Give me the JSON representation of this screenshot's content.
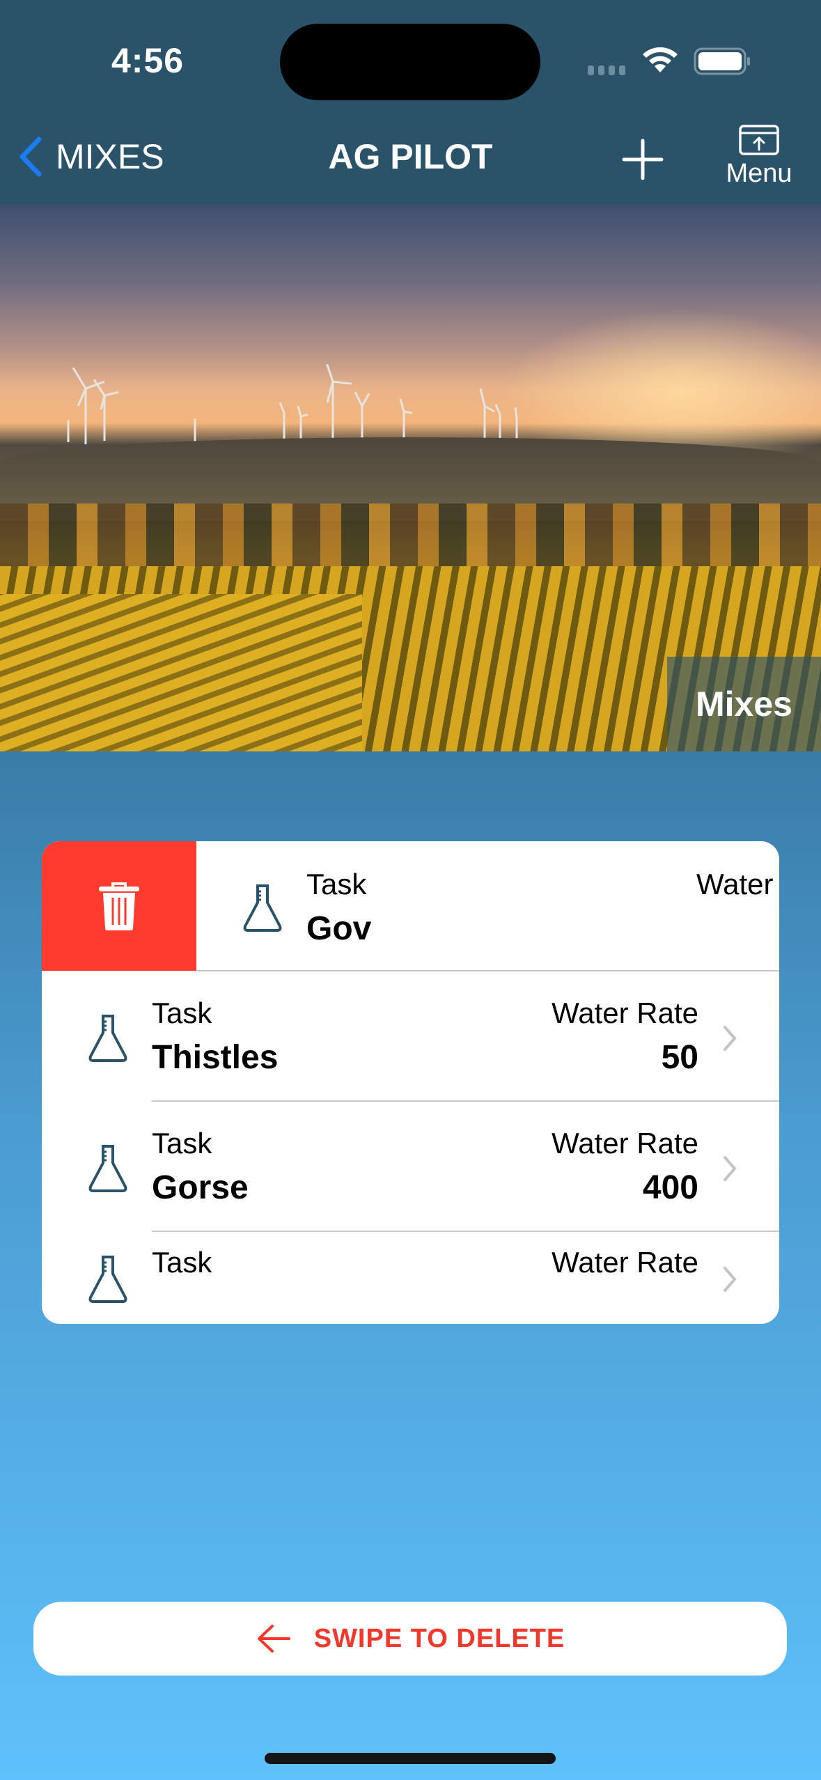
{
  "status_bar": {
    "time": "4:56",
    "icons": [
      "cellular-signal-icon",
      "wifi-icon",
      "battery-icon"
    ]
  },
  "nav": {
    "back_label": "MIXES",
    "title": "AG PILOT",
    "add_icon": "plus-icon",
    "menu_label": "Menu",
    "menu_icon": "share-upload-icon"
  },
  "hero": {
    "badge_label": "Mixes",
    "image_description": "sunset over vineyard with wind turbines"
  },
  "list": {
    "swipe_action": {
      "icon": "trash-icon",
      "color": "#ff3b30"
    },
    "rows": [
      {
        "task_label": "Task",
        "task_name": "Gov",
        "rate_label": "Water",
        "rate_value": ""
      },
      {
        "task_label": "Task",
        "task_name": "Thistles",
        "rate_label": "Water Rate",
        "rate_value": "50"
      },
      {
        "task_label": "Task",
        "task_name": "Gorse",
        "rate_label": "Water Rate",
        "rate_value": "400"
      },
      {
        "task_label": "Task",
        "task_name": "",
        "rate_label": "Water Rate",
        "rate_value": ""
      }
    ]
  },
  "footer": {
    "swipe_hint_label": "SWIPE TO DELETE",
    "swipe_hint_icon": "arrow-left-icon",
    "accent_color": "#f0392c"
  },
  "colors": {
    "nav_bar": "#2a5369",
    "icon_tint": "#2a5369",
    "back_chevron": "#1a7cf5",
    "background_top": "#3a7ca8",
    "background_bottom": "#5fc1fb"
  }
}
